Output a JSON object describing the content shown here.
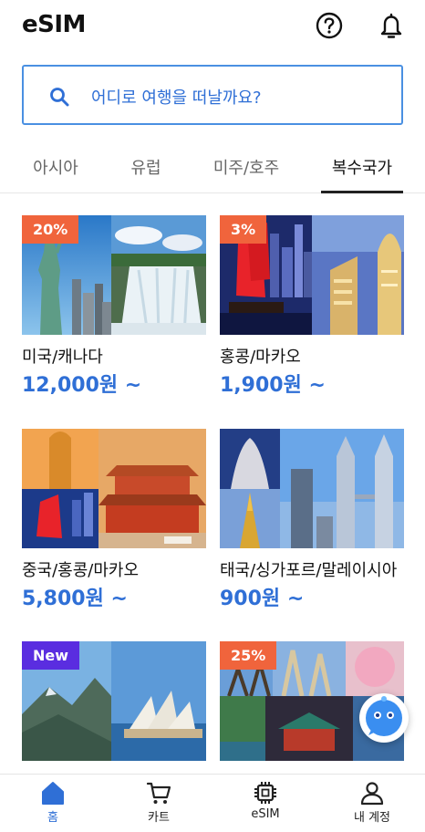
{
  "header": {
    "title": "eSIM",
    "help_icon": "question-circle-icon",
    "notification_icon": "bell-icon"
  },
  "search": {
    "placeholder": "어디로 여행을 떠날까요?",
    "icon": "search-icon"
  },
  "tabs": [
    {
      "label": "아시아",
      "active": false
    },
    {
      "label": "유럽",
      "active": false
    },
    {
      "label": "미주/호주",
      "active": false
    },
    {
      "label": "복수국가",
      "active": true
    }
  ],
  "products": [
    {
      "name": "미국/캐나다",
      "price": "12,000원 ~",
      "badge": "20%",
      "badge_type": "sale"
    },
    {
      "name": "홍콩/마카오",
      "price": "1,900원 ~",
      "badge": "3%",
      "badge_type": "sale"
    },
    {
      "name": "중국/홍콩/마카오",
      "price": "5,800원 ~",
      "badge": "",
      "badge_type": ""
    },
    {
      "name": "태국/싱가포르/말레이시아",
      "price": "900원 ~",
      "badge": "",
      "badge_type": ""
    },
    {
      "name": "",
      "price": "",
      "badge": "New",
      "badge_type": "new"
    },
    {
      "name": "",
      "price": "",
      "badge": "25%",
      "badge_type": "sale"
    }
  ],
  "chat": {
    "icon": "chatbot-icon"
  },
  "bottom_nav": [
    {
      "label": "홈",
      "icon": "home-icon",
      "active": true
    },
    {
      "label": "카트",
      "icon": "cart-icon",
      "active": false
    },
    {
      "label": "eSIM",
      "icon": "chip-icon",
      "active": false
    },
    {
      "label": "내 계정",
      "icon": "person-icon",
      "active": false
    }
  ],
  "colors": {
    "accent": "#2f6fd6",
    "sale_badge": "#f0643c",
    "new_badge": "#5a2de0"
  }
}
